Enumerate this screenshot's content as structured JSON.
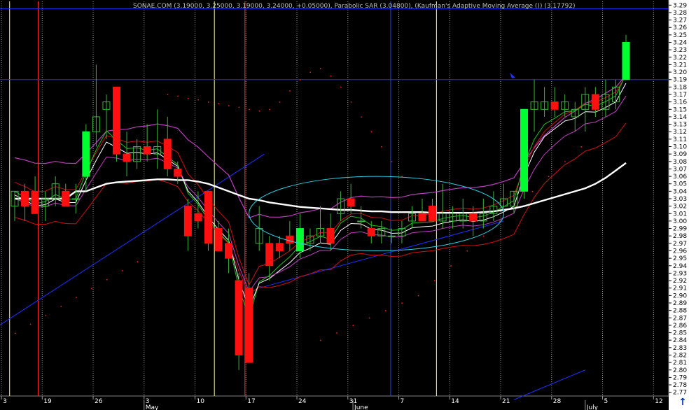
{
  "chart_data": {
    "type": "candlestick",
    "title": "SONAE.COM (3.19000, 3.25000, 3.19000, 3.24000, +0.05000), Parabolic SAR (3.04800), (Kaufman's Adaptive Moving Average ()) (3.17792)",
    "ylim": [
      2.765,
      3.295
    ],
    "y_ticks": [
      "3.29",
      "3.28",
      "3.27",
      "3.26",
      "3.25",
      "3.24",
      "3.23",
      "3.22",
      "3.21",
      "3.20",
      "3.19",
      "3.18",
      "3.17",
      "3.16",
      "3.15",
      "3.14",
      "3.13",
      "3.12",
      "3.11",
      "3.10",
      "3.09",
      "3.08",
      "3.07",
      "3.06",
      "3.05",
      "3.04",
      "3.03",
      "3.02",
      "3.01",
      "3.00",
      "2.99",
      "2.98",
      "2.97",
      "2.96",
      "2.95",
      "2.94",
      "2.93",
      "2.92",
      "2.91",
      "2.90",
      "2.89",
      "2.88",
      "2.87",
      "2.86",
      "2.85",
      "2.84",
      "2.83",
      "2.82",
      "2.81",
      "2.80",
      "2.79",
      "2.78",
      "2.77"
    ],
    "x_day_ticks": [
      {
        "label": "3",
        "slot": -1.3
      },
      {
        "label": "19",
        "slot": 2.7
      },
      {
        "label": "26",
        "slot": 7.7
      },
      {
        "label": "3",
        "slot": 12.7
      },
      {
        "label": "10",
        "slot": 17.7
      },
      {
        "label": "17",
        "slot": 22.7
      },
      {
        "label": "24",
        "slot": 27.7
      },
      {
        "label": "31",
        "slot": 32.7
      },
      {
        "label": "7",
        "slot": 37.7
      },
      {
        "label": "14",
        "slot": 42.7
      },
      {
        "label": "21",
        "slot": 47.7
      },
      {
        "label": "28",
        "slot": 52.7
      },
      {
        "label": "5",
        "slot": 57.7
      },
      {
        "label": "12",
        "slot": 62.7
      }
    ],
    "x_month_ticks": [
      {
        "label": "May",
        "slot": 12.7
      },
      {
        "label": "June",
        "slot": 33.2
      },
      {
        "label": "July",
        "slot": 56.0
      }
    ],
    "candles": [
      {
        "o": 3.02,
        "h": 3.04,
        "l": 3.0,
        "c": 3.04
      },
      {
        "o": 3.04,
        "h": 3.05,
        "l": 3.0,
        "c": 3.02
      },
      {
        "o": 3.04,
        "h": 3.06,
        "l": 3.01,
        "c": 3.01
      },
      {
        "o": 3.02,
        "h": 3.04,
        "l": 3.0,
        "c": 3.03
      },
      {
        "o": 3.03,
        "h": 3.06,
        "l": 3.02,
        "c": 3.05
      },
      {
        "o": 3.04,
        "h": 3.05,
        "l": 3.02,
        "c": 3.02
      },
      {
        "o": 3.03,
        "h": 3.05,
        "l": 3.01,
        "c": 3.03
      },
      {
        "o": 3.06,
        "h": 3.13,
        "l": 3.04,
        "c": 3.12
      },
      {
        "o": 3.12,
        "h": 3.21,
        "l": 3.1,
        "c": 3.14
      },
      {
        "o": 3.15,
        "h": 3.17,
        "l": 3.11,
        "c": 3.16
      },
      {
        "o": 3.18,
        "h": 3.18,
        "l": 3.08,
        "c": 3.09
      },
      {
        "o": 3.09,
        "h": 3.12,
        "l": 3.06,
        "c": 3.08
      },
      {
        "o": 3.08,
        "h": 3.11,
        "l": 3.07,
        "c": 3.1
      },
      {
        "o": 3.1,
        "h": 3.13,
        "l": 3.08,
        "c": 3.09
      },
      {
        "o": 3.09,
        "h": 3.15,
        "l": 3.07,
        "c": 3.1
      },
      {
        "o": 3.11,
        "h": 3.14,
        "l": 3.06,
        "c": 3.07
      },
      {
        "o": 3.07,
        "h": 3.08,
        "l": 3.05,
        "c": 3.06
      },
      {
        "o": 3.02,
        "h": 3.03,
        "l": 2.96,
        "c": 2.98
      },
      {
        "o": 3.01,
        "h": 3.04,
        "l": 2.99,
        "c": 3.0
      },
      {
        "o": 3.04,
        "h": 3.04,
        "l": 2.96,
        "c": 2.97
      },
      {
        "o": 2.99,
        "h": 3.0,
        "l": 2.96,
        "c": 2.96
      },
      {
        "o": 2.97,
        "h": 2.99,
        "l": 2.93,
        "c": 2.95
      },
      {
        "o": 2.92,
        "h": 2.93,
        "l": 2.8,
        "c": 2.82
      },
      {
        "o": 2.91,
        "h": 2.93,
        "l": 2.81,
        "c": 2.81
      },
      {
        "o": 2.97,
        "h": 3.02,
        "l": 2.96,
        "c": 2.99
      },
      {
        "o": 2.97,
        "h": 2.98,
        "l": 2.92,
        "c": 2.94
      },
      {
        "o": 2.97,
        "h": 2.98,
        "l": 2.95,
        "c": 2.96
      },
      {
        "o": 2.98,
        "h": 3.0,
        "l": 2.96,
        "c": 2.97
      },
      {
        "o": 2.96,
        "h": 3.01,
        "l": 2.95,
        "c": 2.99
      },
      {
        "o": 2.97,
        "h": 2.99,
        "l": 2.96,
        "c": 2.98
      },
      {
        "o": 2.98,
        "h": 3.02,
        "l": 2.97,
        "c": 2.99
      },
      {
        "o": 2.99,
        "h": 3.01,
        "l": 2.96,
        "c": 2.97
      },
      {
        "o": 3.01,
        "h": 3.04,
        "l": 3.0,
        "c": 3.03
      },
      {
        "o": 3.03,
        "h": 3.05,
        "l": 3.01,
        "c": 3.02
      },
      {
        "o": 3.0,
        "h": 3.02,
        "l": 2.99,
        "c": 3.0
      },
      {
        "o": 2.99,
        "h": 3.0,
        "l": 2.97,
        "c": 2.98
      },
      {
        "o": 2.98,
        "h": 3.0,
        "l": 2.97,
        "c": 2.99
      },
      {
        "o": 2.98,
        "h": 2.99,
        "l": 2.97,
        "c": 2.98
      },
      {
        "o": 2.98,
        "h": 3.0,
        "l": 2.97,
        "c": 2.99
      },
      {
        "o": 3.0,
        "h": 3.02,
        "l": 2.99,
        "c": 3.01
      },
      {
        "o": 3.01,
        "h": 3.03,
        "l": 3.0,
        "c": 3.0
      },
      {
        "o": 3.02,
        "h": 3.03,
        "l": 3.0,
        "c": 3.0
      },
      {
        "o": 3.0,
        "h": 3.05,
        "l": 2.99,
        "c": 3.01
      },
      {
        "o": 3.0,
        "h": 3.02,
        "l": 2.99,
        "c": 3.01
      },
      {
        "o": 3.0,
        "h": 3.03,
        "l": 2.99,
        "c": 3.01
      },
      {
        "o": 3.01,
        "h": 3.02,
        "l": 2.98,
        "c": 3.0
      },
      {
        "o": 3.0,
        "h": 3.03,
        "l": 2.99,
        "c": 3.01
      },
      {
        "o": 3.01,
        "h": 3.04,
        "l": 3.0,
        "c": 3.02
      },
      {
        "o": 3.02,
        "h": 3.05,
        "l": 3.01,
        "c": 3.03
      },
      {
        "o": 3.02,
        "h": 3.04,
        "l": 3.01,
        "c": 3.04
      },
      {
        "o": 3.04,
        "h": 3.15,
        "l": 3.03,
        "c": 3.15
      },
      {
        "o": 3.15,
        "h": 3.19,
        "l": 3.12,
        "c": 3.16
      },
      {
        "o": 3.15,
        "h": 3.18,
        "l": 3.14,
        "c": 3.16
      },
      {
        "o": 3.16,
        "h": 3.18,
        "l": 3.14,
        "c": 3.15
      },
      {
        "o": 3.15,
        "h": 3.17,
        "l": 3.14,
        "c": 3.16
      },
      {
        "o": 3.14,
        "h": 3.16,
        "l": 3.12,
        "c": 3.15
      },
      {
        "o": 3.15,
        "h": 3.18,
        "l": 3.12,
        "c": 3.17
      },
      {
        "o": 3.17,
        "h": 3.18,
        "l": 3.14,
        "c": 3.15
      },
      {
        "o": 3.15,
        "h": 3.19,
        "l": 3.14,
        "c": 3.17
      },
      {
        "o": 3.16,
        "h": 3.19,
        "l": 3.15,
        "c": 3.18
      },
      {
        "o": 3.19,
        "h": 3.25,
        "l": 3.19,
        "c": 3.24
      }
    ],
    "kama": [
      3.03,
      3.03,
      3.03,
      3.03,
      3.03,
      3.03,
      3.04,
      3.04,
      3.045,
      3.05,
      3.052,
      3.053,
      3.054,
      3.055,
      3.056,
      3.056,
      3.055,
      3.055,
      3.053,
      3.05,
      3.045,
      3.04,
      3.035,
      3.03,
      3.028,
      3.025,
      3.023,
      3.021,
      3.019,
      3.018,
      3.017,
      3.016,
      3.015,
      3.015,
      3.014,
      3.013,
      3.013,
      3.012,
      3.012,
      3.012,
      3.012,
      3.011,
      3.011,
      3.011,
      3.011,
      3.011,
      3.012,
      3.013,
      3.015,
      3.017,
      3.02,
      3.024,
      3.028,
      3.032,
      3.036,
      3.04,
      3.044,
      3.05,
      3.058,
      3.068,
      3.078
    ],
    "sar_high": [
      3.17,
      3.168,
      3.165,
      3.163,
      3.16,
      3.158,
      3.155,
      3.153,
      3.15,
      3.148,
      3.15,
      3.16,
      3.175,
      3.19,
      3.2,
      3.205,
      3.195,
      3.18,
      3.16,
      3.14,
      3.12,
      3.1,
      3.08,
      3.06
    ],
    "sar_low": [
      2.84,
      2.85,
      2.86,
      2.87,
      2.88,
      2.89,
      2.9,
      2.92,
      2.94,
      2.96,
      2.98,
      3.0,
      3.02,
      3.04,
      3.06,
      3.08,
      3.1
    ],
    "horizontal_lines": [
      3.285,
      3.19
    ],
    "ellipse": {
      "cx_slot": 35.5,
      "cy": 3.01,
      "rx_slots": 12.5,
      "ry": 0.05
    }
  }
}
